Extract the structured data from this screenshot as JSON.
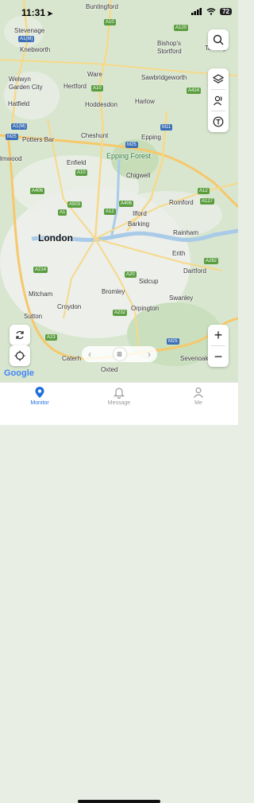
{
  "status_bar": {
    "time": "11:31",
    "battery": "72"
  },
  "map": {
    "places": {
      "buntingford": "Buntingford",
      "stevenage": "Stevenage",
      "knebworth": "Knebworth",
      "bishops_stortford": "Bishop's\nStortford",
      "takeley": "Takeley",
      "welwyn": "Welwyn\nGarden City",
      "ware": "Ware",
      "hertford": "Hertford",
      "sawbridgeworth": "Sawbridgeworth",
      "hatfield": "Hatfield",
      "hoddesdon": "Hoddesdon",
      "harlow": "Harlow",
      "potters_bar": "Potters Bar",
      "cheshunt": "Cheshunt",
      "epping": "Epping",
      "epping_forest": "Epping Forest",
      "enfield": "Enfield",
      "chigwell": "Chigwell",
      "elmwood": "lmwood",
      "romford": "Romford",
      "ilford": "Ilford",
      "barking": "Barking",
      "london": "London",
      "rainham": "Rainham",
      "erith": "Erith",
      "dartford": "Dartford",
      "sidcup": "Sidcup",
      "mitcham": "Mitcham",
      "bromley": "Bromley",
      "swanley": "Swanley",
      "sutton": "Sutton",
      "croydon": "Croydon",
      "orpington": "Orpington",
      "caterham": "Caterh",
      "sevenoaks": "Sevenoaks",
      "oxted": "Oxted"
    },
    "roads": {
      "a10_top": "A10",
      "a1m_top": "A1(M)",
      "a120": "A120",
      "a10_mid": "A10",
      "a414": "A414",
      "a1m_left": "A1(M)",
      "m11": "M11",
      "m25_left": "M25",
      "m25_mid": "M25",
      "a10_low": "A10",
      "a406_left": "A406",
      "a503": "A503",
      "a406_right": "A406",
      "a1": "A1",
      "a12_mid": "A12",
      "a12_right": "A12",
      "a127": "A127",
      "a214": "A214",
      "a20": "A20",
      "a282": "A282",
      "a232": "A232",
      "a23": "A23",
      "m25_bottom": "M25"
    },
    "attribution": "Google"
  },
  "controls": {
    "search_icon": "search-icon",
    "layers_icon": "layers-icon",
    "contacts_icon": "contacts-icon",
    "traffic_icon": "traffic-icon",
    "zoom_in": "+",
    "zoom_out": "−"
  },
  "tabs": [
    {
      "label": "Monitor",
      "active": true
    },
    {
      "label": "Message",
      "active": false
    },
    {
      "label": "Me",
      "active": false
    }
  ],
  "colors": {
    "accent": "#1e6fe0",
    "water": "#a9cbe8",
    "urban": "#eef0ec",
    "green": "#cfe2c2"
  }
}
